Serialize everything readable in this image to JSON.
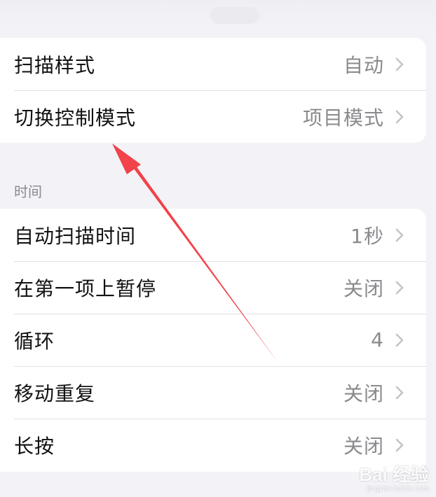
{
  "groups": [
    {
      "rows": [
        {
          "label": "扫描样式",
          "value": "自动"
        },
        {
          "label": "切换控制模式",
          "value": "项目模式"
        }
      ]
    },
    {
      "header": "时间",
      "rows": [
        {
          "label": "自动扫描时间",
          "value": "1秒"
        },
        {
          "label": "在第一项上暂停",
          "value": "关闭"
        },
        {
          "label": "循环",
          "value": "4"
        },
        {
          "label": "移动重复",
          "value": "关闭"
        },
        {
          "label": "长按",
          "value": "关闭"
        }
      ]
    }
  ],
  "annotation": {
    "arrow_color": "#f2424a"
  },
  "watermark": {
    "logo": "Bai 经验",
    "site": "jingyan.baidu.com"
  },
  "colors": {
    "background": "#f2f2f7",
    "card": "#ffffff",
    "secondary_text": "#8a8a8e"
  }
}
